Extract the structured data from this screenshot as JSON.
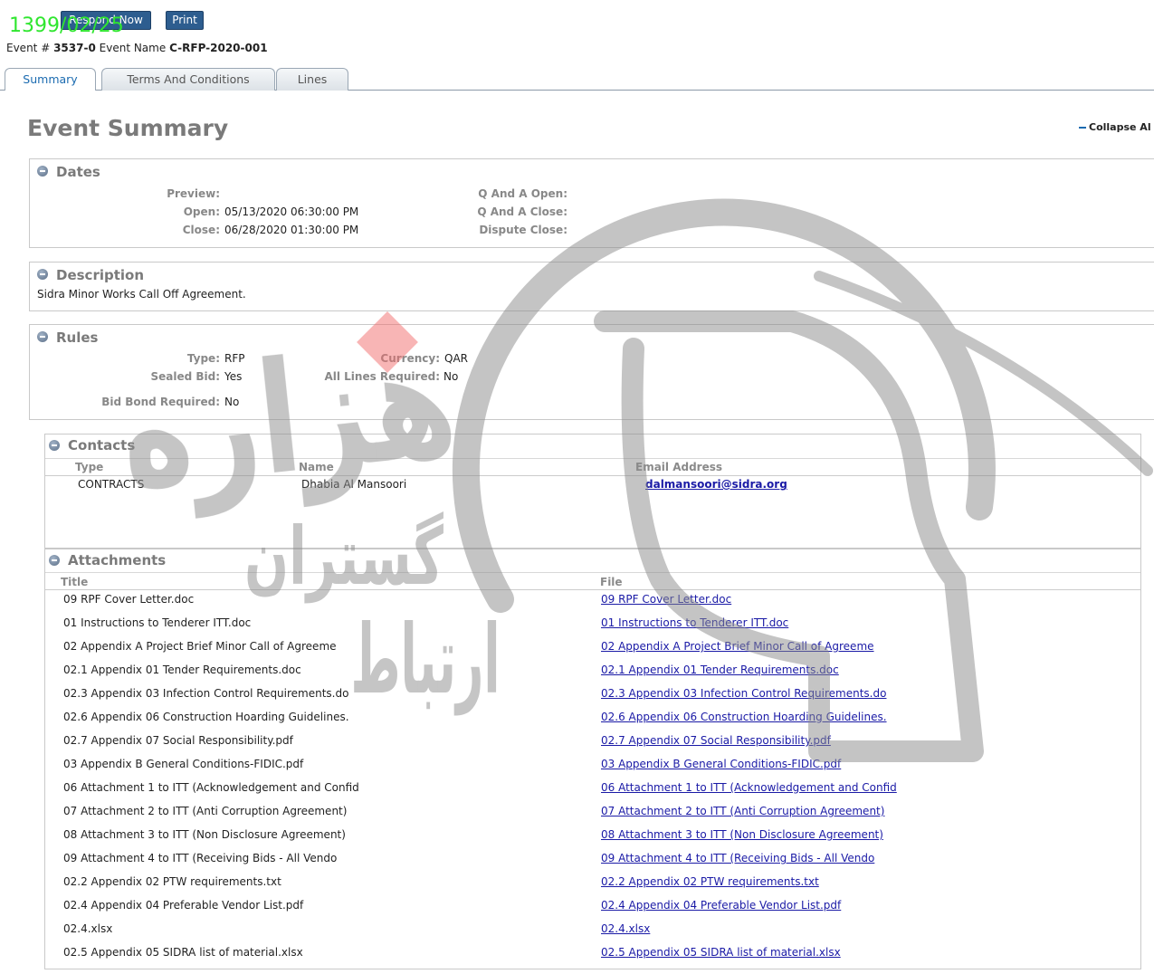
{
  "date_stamp": "1399/02/25",
  "toolbar": {
    "respond_label": "Respond Now",
    "print_label": "Print"
  },
  "event": {
    "number_label": "Event #",
    "number": "3537-0",
    "name_label": "Event Name",
    "name": "C-RFP-2020-001"
  },
  "tabs": [
    {
      "label": "Summary",
      "active": true
    },
    {
      "label": "Terms And Conditions",
      "active": false
    },
    {
      "label": "Lines",
      "active": false
    }
  ],
  "summary": {
    "title": "Event Summary",
    "collapse_label": "Collapse Al"
  },
  "dates": {
    "title": "Dates",
    "preview_label": "Preview:",
    "open_label": "Open:",
    "open_value": "05/13/2020 06:30:00 PM",
    "close_label": "Close:",
    "close_value": "06/28/2020 01:30:00 PM",
    "qa_open_label": "Q And A Open:",
    "qa_close_label": "Q And A Close:",
    "dispute_close_label": "Dispute Close:"
  },
  "description": {
    "title": "Description",
    "text": "Sidra Minor Works Call Off Agreement."
  },
  "rules": {
    "title": "Rules",
    "type_label": "Type:",
    "type": "RFP",
    "currency_label": "Currency:",
    "currency": "QAR",
    "sealed_bid_label": "Sealed Bid:",
    "sealed_bid": "Yes",
    "all_lines_label": "All Lines Required:",
    "all_lines": "No",
    "bid_bond_label": "Bid Bond Required:",
    "bid_bond": "No"
  },
  "contacts": {
    "title": "Contacts",
    "columns": [
      "Type",
      "Name",
      "Email Address"
    ],
    "rows": [
      {
        "type": "CONTRACTS",
        "name": "Dhabia Al Mansoori",
        "email": "dalmansoori@sidra.org"
      }
    ]
  },
  "attachments": {
    "title": "Attachments",
    "columns": [
      "Title",
      "File"
    ],
    "rows": [
      {
        "title": "09 RPF Cover Letter.doc",
        "file": "09 RPF Cover Letter.doc"
      },
      {
        "title": "01 Instructions to Tenderer ITT.doc",
        "file": "01 Instructions to Tenderer ITT.doc"
      },
      {
        "title": "02 Appendix A Project Brief Minor Call of Agreeme",
        "file": "02 Appendix A Project Brief Minor Call of Agreeme"
      },
      {
        "title": "02.1 Appendix 01 Tender Requirements.doc",
        "file": "02.1 Appendix 01 Tender Requirements.doc"
      },
      {
        "title": "02.3 Appendix 03 Infection Control Requirements.do",
        "file": "02.3 Appendix 03 Infection Control Requirements.do"
      },
      {
        "title": "02.6 Appendix 06 Construction Hoarding Guidelines.",
        "file": "02.6 Appendix 06 Construction Hoarding Guidelines."
      },
      {
        "title": "02.7 Appendix 07 Social Responsibility.pdf",
        "file": "02.7 Appendix 07 Social Responsibility.pdf"
      },
      {
        "title": "03 Appendix B General Conditions-FIDIC.pdf",
        "file": "03 Appendix B General Conditions-FIDIC.pdf"
      },
      {
        "title": "06 Attachment 1 to ITT (Acknowledgement and Confid",
        "file": "06 Attachment 1 to ITT (Acknowledgement and Confid"
      },
      {
        "title": "07 Attachment 2 to ITT (Anti Corruption Agreement)",
        "file": "07 Attachment 2 to ITT (Anti Corruption Agreement)"
      },
      {
        "title": "08 Attachment 3 to ITT (Non Disclosure Agreement)",
        "file": "08 Attachment 3 to ITT (Non Disclosure Agreement)"
      },
      {
        "title": "09 Attachment 4 to ITT (Receiving Bids - All Vendo",
        "file": "09 Attachment 4 to ITT (Receiving Bids - All Vendo"
      },
      {
        "title": "02.2 Appendix 02 PTW requirements.txt",
        "file": "02.2 Appendix 02 PTW requirements.txt"
      },
      {
        "title": "02.4 Appendix 04 Preferable Vendor List.pdf",
        "file": "02.4 Appendix 04 Preferable Vendor List.pdf"
      },
      {
        "title": "02.4.xlsx",
        "file": "02.4.xlsx"
      },
      {
        "title": "02.5 Appendix 05 SIDRA list of material.xlsx",
        "file": "02.5 Appendix 05 SIDRA list of material.xlsx"
      }
    ]
  },
  "watermark": {
    "brand_line1": "هزاره",
    "brand_line2": "گستران",
    "brand_line3": "ارتباط"
  },
  "icons": {
    "section_toggle": "minus-circle-icon",
    "collapse": "collapse-dash-icon"
  },
  "colors": {
    "date_stamp": "#2fe62f",
    "button": "#2d5d8f",
    "link": "#1a1aa6",
    "active_tab_text": "#1b6bb0",
    "watermark_gray": "#8a8a8a",
    "watermark_red": "#f26b6b"
  }
}
